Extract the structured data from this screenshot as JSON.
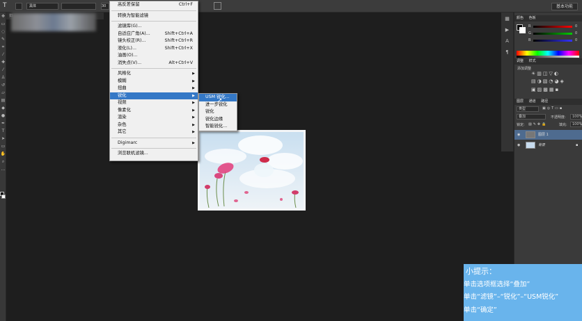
{
  "options_bar": {
    "tool_glyph": "T",
    "font_family_value": "黑体",
    "font_size_value": "30",
    "workspace_label": "基本功能"
  },
  "document": {
    "tab_label": "如"
  },
  "filter_menu": {
    "items": [
      {
        "label": "高反差保留",
        "shortcut": "Ctrl+F"
      },
      {
        "label": "转换为智能滤镜"
      },
      {
        "label": "滤镜库(G)..."
      },
      {
        "label": "自适应广角(A)...",
        "shortcut": "Shift+Ctrl+A"
      },
      {
        "label": "镜头校正(R)...",
        "shortcut": "Shift+Ctrl+R"
      },
      {
        "label": "液化(L)...",
        "shortcut": "Shift+Ctrl+X"
      },
      {
        "label": "油画(O)..."
      },
      {
        "label": "消失点(V)...",
        "shortcut": "Alt+Ctrl+V"
      },
      {
        "label": "风格化"
      },
      {
        "label": "模糊"
      },
      {
        "label": "扭曲"
      },
      {
        "label": "锐化"
      },
      {
        "label": "视频"
      },
      {
        "label": "像素化"
      },
      {
        "label": "渲染"
      },
      {
        "label": "杂色"
      },
      {
        "label": "其它"
      },
      {
        "label": "Digimarc"
      },
      {
        "label": "浏览联机滤镜..."
      }
    ]
  },
  "sharpen_submenu": {
    "items": [
      {
        "label": "USM 锐化..."
      },
      {
        "label": "进一步锐化"
      },
      {
        "label": "锐化"
      },
      {
        "label": "锐化边缘"
      },
      {
        "label": "智能锐化..."
      }
    ]
  },
  "right_panel": {
    "color_tabs": [
      "颜色",
      "色板"
    ],
    "channel_r": "R",
    "channel_g": "G",
    "channel_b": "B",
    "channel_r_value": "0",
    "channel_g_value": "0",
    "channel_b_value": "0",
    "adjust_tabs": [
      "调整",
      "样式"
    ],
    "adjust_hint": "添加调整",
    "layers_tabs": [
      "图层",
      "通道",
      "路径"
    ],
    "kind_label": "类型",
    "blend_mode": "叠加",
    "opacity_label": "不透明度:",
    "opacity_value": "100%",
    "lock_label": "锁定:",
    "fill_label": "填充:",
    "fill_value": "100%",
    "layers": [
      {
        "name": "图层 1"
      },
      {
        "name": "背景"
      }
    ]
  },
  "tip": {
    "title": "小提示：",
    "lines": [
      "单击选项框选择“叠加”",
      "单击“滤镜”–“锐化”–“USM锐化”",
      "单击“确定”"
    ]
  },
  "colors": {
    "menu_highlight": "#3478c6",
    "tip_background": "#69b4ec",
    "workspace_background": "#1e1e1e"
  }
}
